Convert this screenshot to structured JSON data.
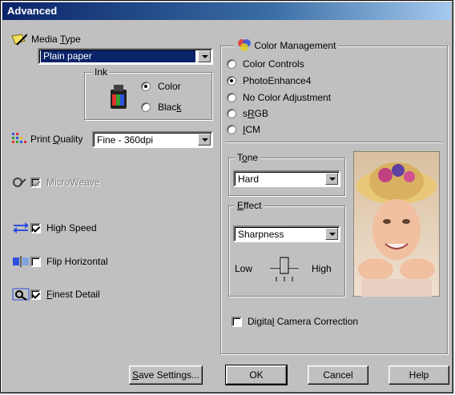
{
  "window": {
    "title": "Advanced"
  },
  "media": {
    "label_pre": "Media ",
    "label_u": "T",
    "label_post": "ype",
    "value": "Plain paper"
  },
  "ink": {
    "title": "Ink",
    "color_label": "Color",
    "black_pre": "Blac",
    "black_u": "k",
    "selected": "Color"
  },
  "print_quality": {
    "label_pre": "Print ",
    "label_u": "Q",
    "label_post": "uality",
    "value": "Fine - 360dpi"
  },
  "options": {
    "microweave": {
      "label": "MicroWeave",
      "checked": true,
      "enabled": false
    },
    "high_speed": {
      "label": "High Speed",
      "checked": true
    },
    "flip_horizontal": {
      "label": "Flip Horizontal",
      "checked": false
    },
    "finest_detail_u": "F",
    "finest_detail_rest": "inest Detail"
  },
  "color_management": {
    "title": "Color Management",
    "options": [
      {
        "label": "Color Controls",
        "selected": false
      },
      {
        "label": "PhotoEnhance4",
        "selected": true
      },
      {
        "label": "No Color Adjustment",
        "selected": false
      },
      {
        "label_pre": "s",
        "label_u": "R",
        "label_post": "GB",
        "selected": false
      },
      {
        "label_u": "I",
        "label_post": "CM",
        "selected": false
      }
    ]
  },
  "tone": {
    "title_pre": "T",
    "title_u": "o",
    "title_post": "ne",
    "value": "Hard"
  },
  "effect": {
    "title_u": "E",
    "title_post": "ffect",
    "value": "Sharpness",
    "low_label": "Low",
    "high_label": "High",
    "slider_level": 0.5
  },
  "digital_camera": {
    "label_pre": "Digita",
    "label_u": "l",
    "label_post": " Camera Correction",
    "checked": false
  },
  "buttons": {
    "save_u": "S",
    "save_rest": "ave Settings...",
    "ok": "OK",
    "cancel": "Cancel",
    "help": "Help"
  },
  "colors": {
    "dialog": "#c0c0c0",
    "title_bar": "#0a246a",
    "selection": "#0a246a"
  }
}
